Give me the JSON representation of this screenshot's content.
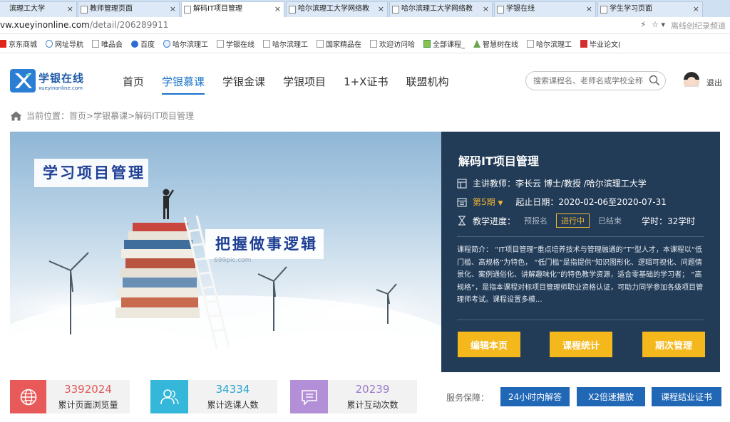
{
  "browser": {
    "tabs": [
      {
        "label": "滨理工大学",
        "active": false
      },
      {
        "label": "教师管理页面",
        "active": false
      },
      {
        "label": "解码IT项目管理",
        "active": true
      },
      {
        "label": "哈尔滨理工大学网络教",
        "active": false
      },
      {
        "label": "哈尔滨理工大学网络教",
        "active": false
      },
      {
        "label": "学银在线",
        "active": false
      },
      {
        "label": "学生学习页面",
        "active": false
      }
    ],
    "close_glyph": "×",
    "url_host": "vw.xueyinonline.com",
    "url_path": "/detail/206289911",
    "lightning_icon": "lightning-icon",
    "star_icon": "star-icon",
    "private_mode_label": "离线创纪录频道",
    "bookmarks": [
      {
        "label": "京东商城",
        "icon": "jd-icon"
      },
      {
        "label": "网址导航",
        "icon": "globe-icon"
      },
      {
        "label": "唯品会",
        "icon": "page-icon"
      },
      {
        "label": "百度",
        "icon": "baidu-icon"
      },
      {
        "label": "哈尔滨理工",
        "icon": "hrb-icon"
      },
      {
        "label": "学银在线",
        "icon": "page-icon"
      },
      {
        "label": "哈尔滨理工",
        "icon": "page-icon"
      },
      {
        "label": "国家精品在",
        "icon": "page-icon"
      },
      {
        "label": "欢迎访问哈",
        "icon": "page-icon"
      },
      {
        "label": "全部课程_",
        "icon": "map-icon"
      },
      {
        "label": "智慧树在线",
        "icon": "tree-icon"
      },
      {
        "label": "哈尔滨理工",
        "icon": "page-icon"
      },
      {
        "label": "毕业论文(",
        "icon": "yy-icon"
      }
    ]
  },
  "site": {
    "logo_title": "学银在线",
    "logo_sub": "xueyinonline.com",
    "nav": [
      {
        "label": "首页",
        "active": false
      },
      {
        "label": "学银慕课",
        "active": true
      },
      {
        "label": "学银金课",
        "active": false
      },
      {
        "label": "学银项目",
        "active": false
      },
      {
        "label": "1+X证书",
        "active": false
      },
      {
        "label": "联盟机构",
        "active": false
      }
    ],
    "search_placeholder": "搜索课程名、老师名或学校全称",
    "logout": "退出"
  },
  "breadcrumb": {
    "prefix": "当前位置：",
    "items": [
      "首页",
      "学银慕课",
      "解码IT项目管理"
    ],
    "separator": " > "
  },
  "hero": {
    "banner_1": "学习项目管理",
    "banner_2": "把握做事逻辑",
    "watermark": "699pic.com"
  },
  "course": {
    "title": "解码IT项目管理",
    "teacher_label": "主讲教师：",
    "teacher": "李长云 博士/教授 /哈尔滨理工大学",
    "period": "第5期",
    "period_caret": "▼",
    "date_label": "起止日期：",
    "dates": "2020-02-06至2020-07-31",
    "progress_label": "教学进度：",
    "progress_steps": [
      "预报名",
      "进行中",
      "已结束"
    ],
    "progress_current": "进行中",
    "hours_label": "学时：",
    "hours": "32学时",
    "intro": "课程简介：  “IT项目管理”重点培养技术与管理融通的“T”型人才，本课程以“低门槛、高规格”为特色，  “低门槛”是指提供“知识图形化、逻辑可视化、问题情景化、案例通俗化、讲解趣味化”的特色教学资源，适合零基础的学习者；  “高规格”，是指本课程对标项目管理师职业资格认证，可助力同学参加各级项目管理师考试。课程设置多模...",
    "buttons": {
      "edit": "编辑本页",
      "stats": "课程统计",
      "periods": "期次管理"
    }
  },
  "stats": [
    {
      "value": "3392024",
      "label": "累计页面浏览量",
      "icon": "globe-icon",
      "color": "#e85a5a"
    },
    {
      "value": "34334",
      "label": "累计选课人数",
      "icon": "users-icon",
      "color": "#34b7d8"
    },
    {
      "value": "20239",
      "label": "累计互动次数",
      "icon": "chat-icon",
      "color": "#b28fd6"
    }
  ],
  "guarantee": {
    "label": "服务保障：",
    "items": [
      "24小时内解答",
      "X2倍速播放",
      "课程结业证书"
    ]
  },
  "colors": {
    "accent": "#1a73c8",
    "info_panel": "#223b57",
    "button_yellow": "#f5b81c",
    "guarantee_blue": "#2067b6"
  }
}
